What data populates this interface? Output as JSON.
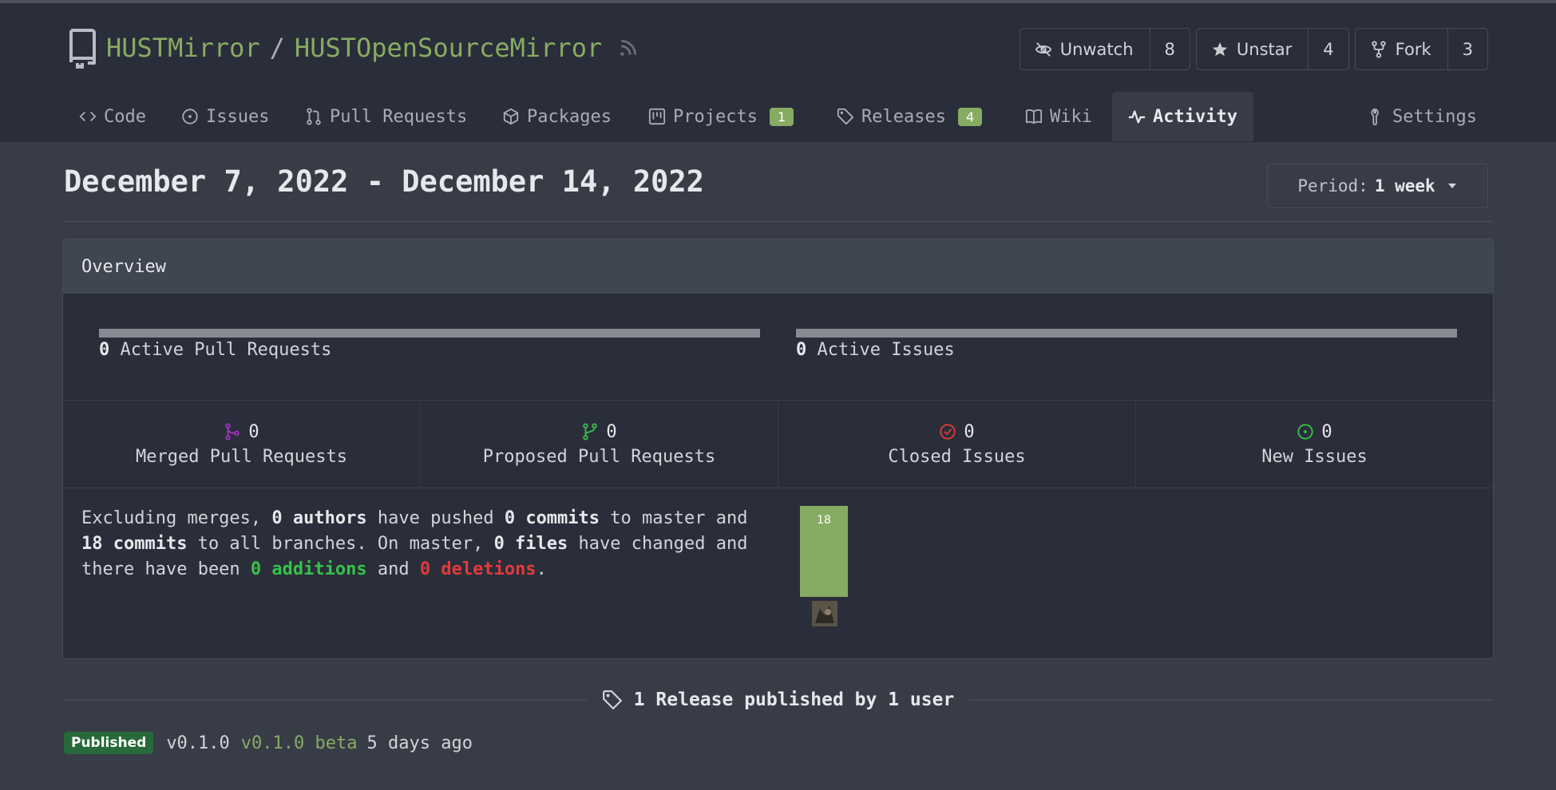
{
  "repo": {
    "owner": "HUSTMirror",
    "separator": "/",
    "name": "HUSTOpenSourceMirror"
  },
  "actions": [
    {
      "label": "Unwatch",
      "count": "8",
      "icon": "eye-slash-icon"
    },
    {
      "label": "Unstar",
      "count": "4",
      "icon": "star-icon"
    },
    {
      "label": "Fork",
      "count": "3",
      "icon": "fork-icon"
    }
  ],
  "tabs": {
    "code": "Code",
    "issues": "Issues",
    "pulls": "Pull Requests",
    "packages": "Packages",
    "projects": "Projects",
    "projects_count": "1",
    "releases": "Releases",
    "releases_count": "4",
    "wiki": "Wiki",
    "activity": "Activity",
    "settings": "Settings"
  },
  "activity": {
    "date_range": "December 7, 2022 - December 14, 2022",
    "period_label": "Period:",
    "period_value": "1 week"
  },
  "overview": {
    "title": "Overview",
    "active_prs_count": "0",
    "active_prs_label": "Active Pull Requests",
    "active_issues_count": "0",
    "active_issues_label": "Active Issues",
    "stats": [
      {
        "count": "0",
        "label": "Merged Pull Requests"
      },
      {
        "count": "0",
        "label": "Proposed Pull Requests"
      },
      {
        "count": "0",
        "label": "Closed Issues"
      },
      {
        "count": "0",
        "label": "New Issues"
      }
    ],
    "summary": {
      "t1": "Excluding merges, ",
      "authors": "0 authors",
      "t2": " have pushed ",
      "commits_master": "0 commits",
      "t3": " to master and ",
      "commits_all": "18 commits",
      "t4": " to all branches. On master, ",
      "files": "0 files",
      "t5": " have changed and there have been ",
      "additions": "0 additions",
      "t6": " and ",
      "deletions": "0 deletions",
      "t7": "."
    },
    "commit_bar_value": "18"
  },
  "colors": {
    "accent": "#87ab63",
    "merged": "#a431c6",
    "proposed": "#35c24a",
    "closed": "#e33a3a",
    "new": "#35c24a"
  },
  "releases": {
    "heading": "1 Release published by 1 user",
    "items": [
      {
        "status": "Published",
        "version": "v0.1.0",
        "title": "v0.1.0 beta",
        "time": "5 days ago"
      }
    ]
  }
}
